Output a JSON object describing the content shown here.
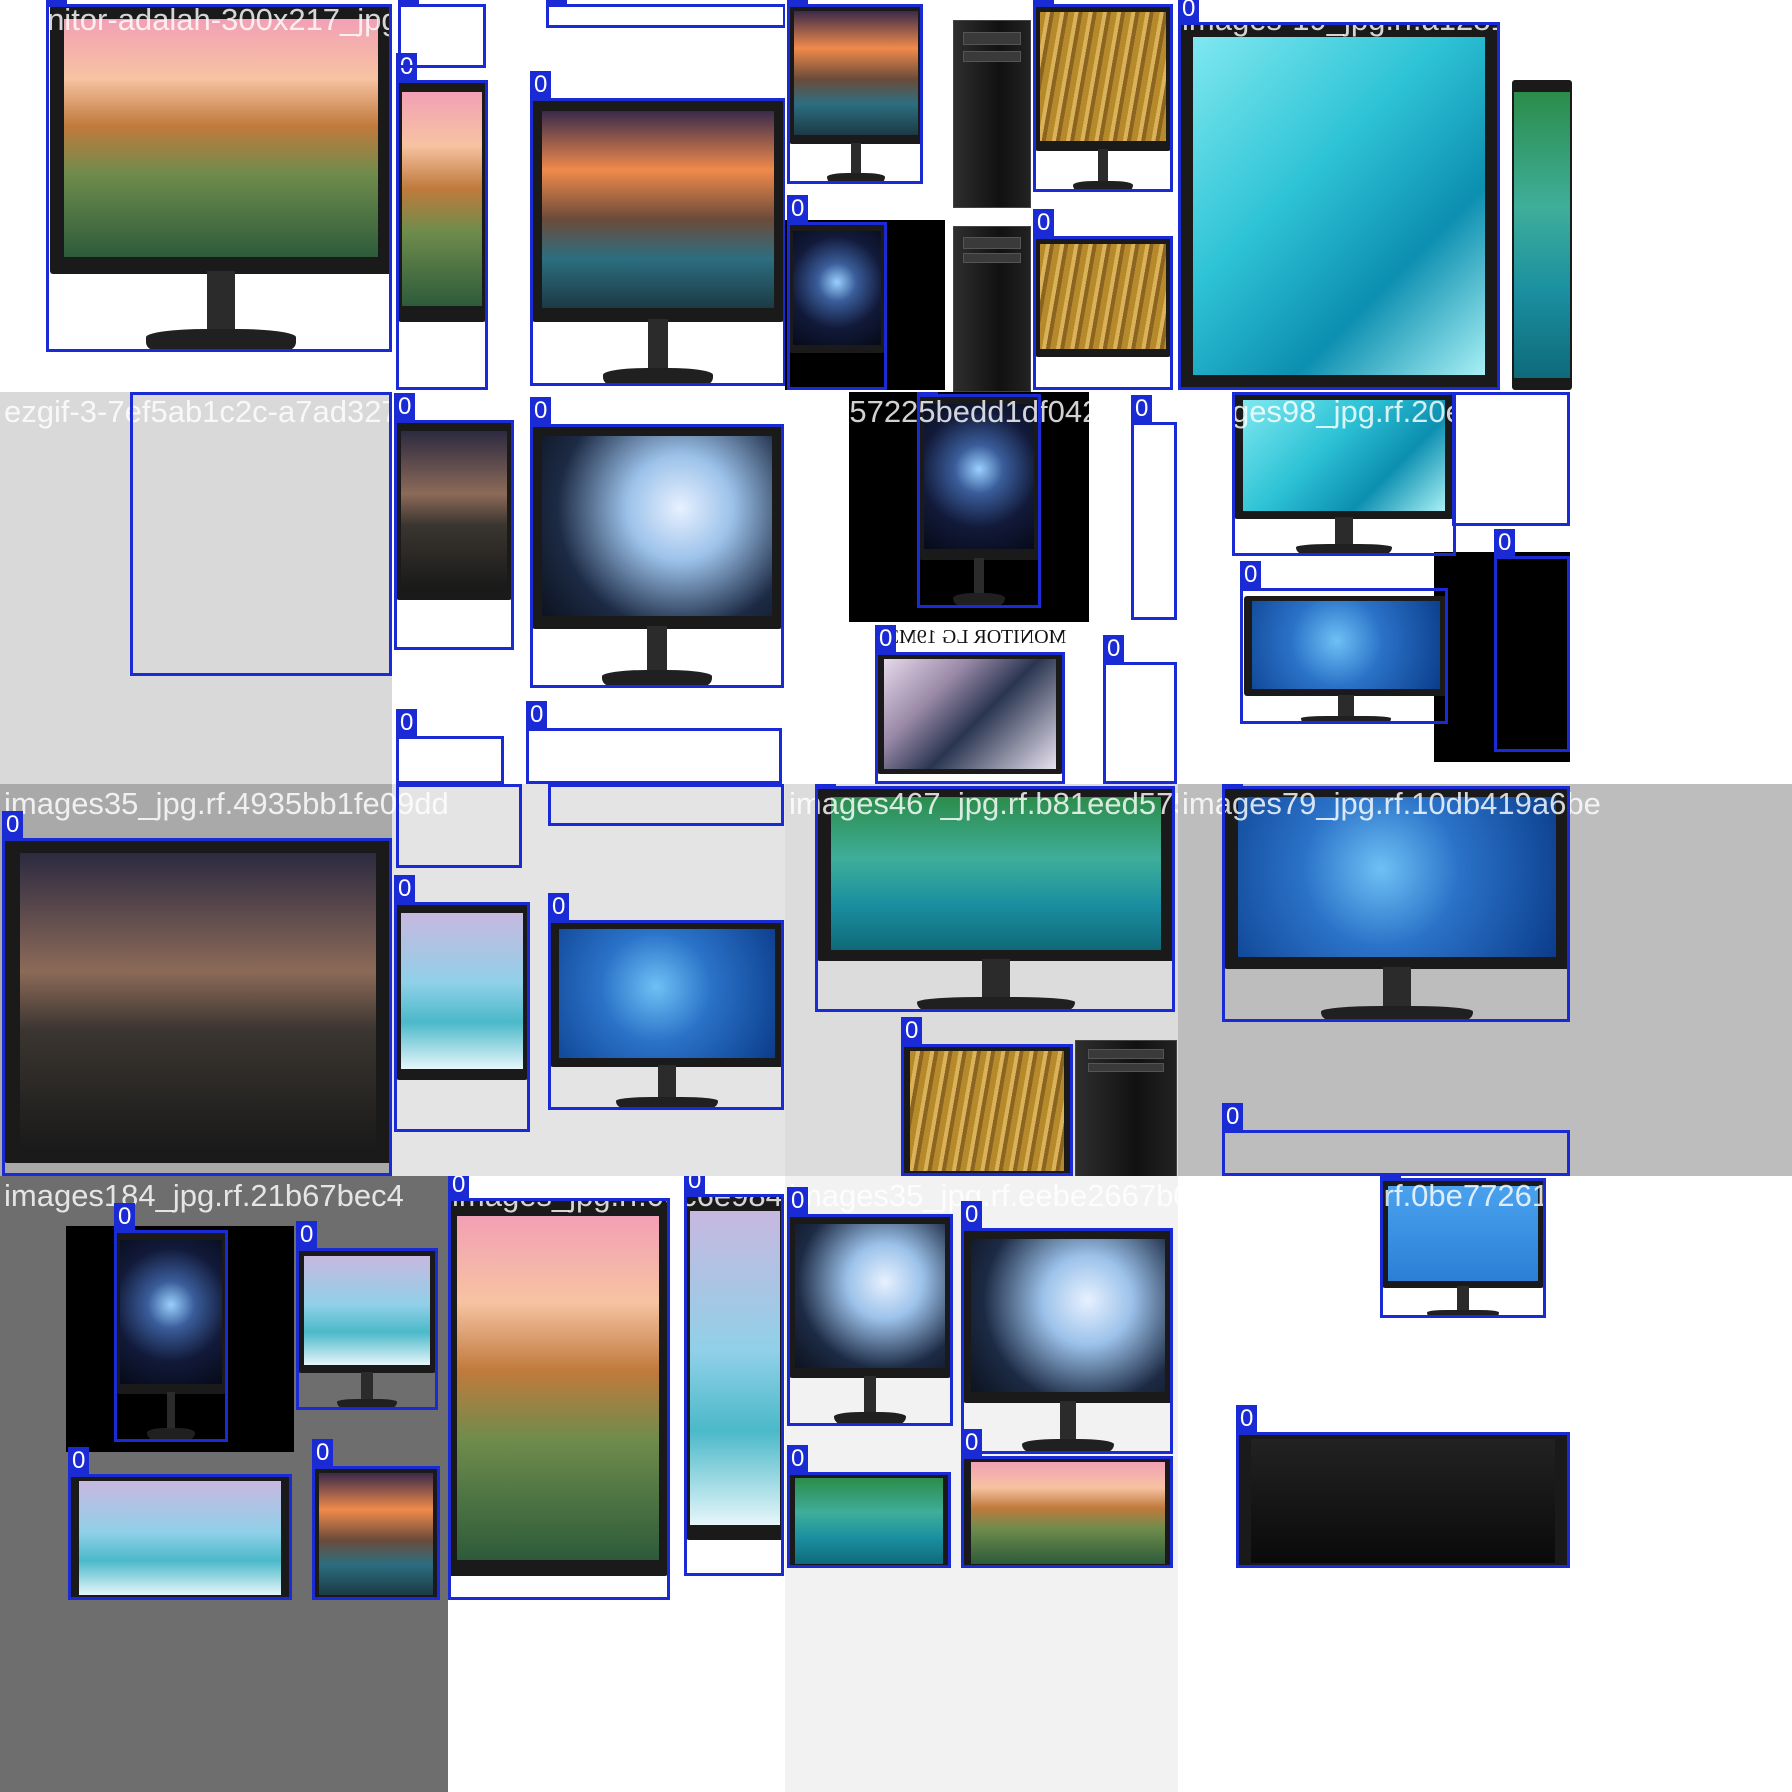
{
  "mosaic": {
    "tiles": [
      {
        "filename": "Monitor-adalah-300x217_jpg.rf.8e705d98c848a7096 lenovo-1623",
        "class_label": "0",
        "boxes": 7
      },
      {
        "filename": "images-19_jpg.rf.a12813d02c",
        "class_label": "0",
        "boxes": 3
      },
      {
        "filename": "ezgif-3-7ef5ab1c2c-a7ad327f7d7339_jpg.rf.eda214be6",
        "class_label": "0",
        "boxes": 5
      },
      {
        "filename": "fbb157225bedd1df04243830fd7",
        "class_label": "0",
        "boxes": 4
      },
      {
        "filename": "images98_jpg.rf.20ec6f565c",
        "class_label": "0",
        "boxes": 4
      },
      {
        "filename": "images35_jpg.rf.4935bb1fe09dd2f3bdbe",
        "class_label": "0",
        "boxes": 4
      },
      {
        "filename": "images467_jpg.rf.b81eed575",
        "class_label": "0",
        "boxes": 2
      },
      {
        "filename": "images79_jpg.rf.10db419a6be",
        "class_label": "0",
        "boxes": 2
      },
      {
        "filename": "images184_jpg.rf.21b67bec4",
        "class_label": "0",
        "boxes": 5
      },
      {
        "filename": "images_jpg.rf.06c6e9848c",
        "class_label": "0",
        "boxes": 2
      },
      {
        "filename": "images35_jpg.rf.eebe2667b0",
        "class_label": "0",
        "boxes": 4
      },
      {
        "filename": "images77_jpg.rf.0be77261235",
        "class_label": "0",
        "boxes": 2
      }
    ],
    "box_label": "0",
    "box_color": "#1a2bd6",
    "embedded_text": {
      "monitor_lg_caption": "MONITOR LG 19M3"
    }
  }
}
